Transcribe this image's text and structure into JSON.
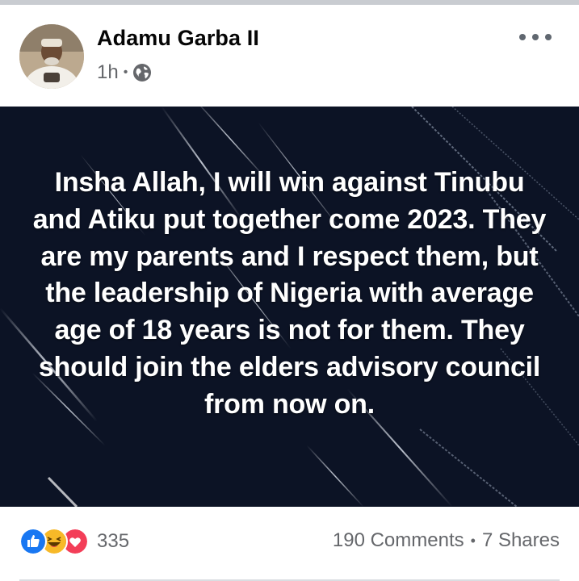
{
  "post": {
    "author": "Adamu Garba II",
    "time": "1h",
    "meta_separator": "•",
    "privacy_icon": "globe-icon",
    "more_icon": "more-options-icon",
    "quote": "Insha Allah, I will win against Tinubu and Atiku put together come 2023. They are my parents and I respect them, but the leadership of Nigeria with average age of 18 years is not for them. They should join the elders advisory council from now on.",
    "reactions": {
      "icons": [
        "like-icon",
        "haha-icon",
        "love-icon"
      ],
      "count": "335"
    },
    "comments": "190 Comments",
    "stats_separator": "•",
    "shares": "7 Shares"
  },
  "colors": {
    "like": "#1877f2",
    "haha": "#f7b928",
    "love": "#f33e58",
    "image_background": "#0c1325",
    "name": "#050505",
    "meta": "#65676b"
  }
}
